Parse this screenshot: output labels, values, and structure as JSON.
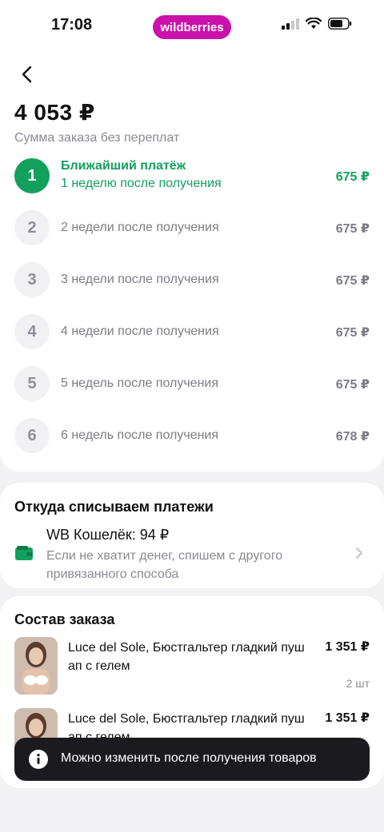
{
  "status_bar": {
    "time": "17:08",
    "brand": "wildberries"
  },
  "header": {
    "total": "4 053 ₽",
    "subtitle": "Сумма заказа без переплат"
  },
  "payments": [
    {
      "num": "1",
      "title": "Ближайший платёж",
      "label": "1 неделю после получения",
      "amount": "675 ₽",
      "active": true
    },
    {
      "num": "2",
      "label": "2 недели после получения",
      "amount": "675 ₽"
    },
    {
      "num": "3",
      "label": "3 недели после получения",
      "amount": "675 ₽"
    },
    {
      "num": "4",
      "label": "4 недели после получения",
      "amount": "675 ₽"
    },
    {
      "num": "5",
      "label": "5 недель после получения",
      "amount": "675 ₽"
    },
    {
      "num": "6",
      "label": "6 недель после получения",
      "amount": "678 ₽"
    }
  ],
  "source": {
    "title": "Откуда списываем платежи",
    "wallet": "WB Кошелёк: 94 ₽",
    "description": "Если не хватит денег, спишем с другого привязанного способа"
  },
  "order": {
    "title": "Состав заказа",
    "items": [
      {
        "name": "Luce del Sole, Бюстгальтер гладкий пуш ап с гелем",
        "price": "1 351 ₽",
        "qty": "2 шт"
      },
      {
        "name": "Luce del Sole, Бюстгальтер гладкий пуш ап с гелем",
        "price": "1 351 ₽",
        "qty": ""
      }
    ]
  },
  "toast": {
    "text": "Можно изменить после получения товаров"
  },
  "colors": {
    "brand": "#cb11ab",
    "accent_green": "#13a05d"
  },
  "icons": [
    "back-arrow-icon",
    "wallet-icon",
    "chevron-right-icon",
    "info-icon",
    "signal-icon",
    "wifi-icon",
    "battery-icon"
  ]
}
